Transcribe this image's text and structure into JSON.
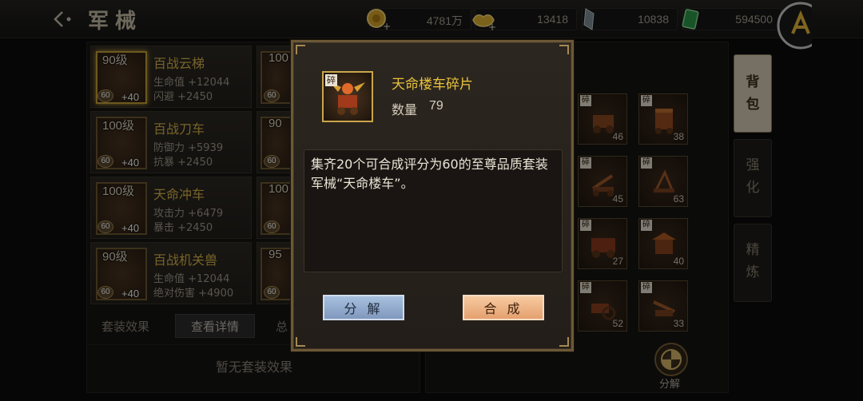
{
  "header": {
    "title": "军械",
    "resources": [
      {
        "icon": "gold-coin-icon",
        "value": "4781万"
      },
      {
        "icon": "gold-ingot-icon",
        "value": "13418"
      },
      {
        "icon": "crystal-icon",
        "value": "10838"
      },
      {
        "icon": "jade-icon",
        "value": "594500"
      }
    ]
  },
  "equipment": [
    {
      "level": "90级",
      "score": "60",
      "plus": "+40",
      "name": "百战云梯",
      "stat1": "生命值 +12044",
      "stat2": "闪避 +2450"
    },
    {
      "level": "100级",
      "score": "60",
      "plus": "+40",
      "name": "百战刀车",
      "stat1": "防御力 +5939",
      "stat2": "抗暴 +2450"
    },
    {
      "level": "100级",
      "score": "60",
      "plus": "+40",
      "name": "天命冲车",
      "stat1": "攻击力 +6479",
      "stat2": "暴击 +2450"
    },
    {
      "level": "90级",
      "score": "60",
      "plus": "+40",
      "name": "百战机关兽",
      "stat1": "生命值 +12044",
      "stat2": "绝对伤害 +4900"
    }
  ],
  "equipment_right": [
    {
      "level": "100",
      "score": "60"
    },
    {
      "level": "90",
      "score": "60"
    },
    {
      "level": "100",
      "score": "60"
    },
    {
      "level": "95",
      "score": "60"
    }
  ],
  "set_section": {
    "label": "套装效果",
    "detail_button": "查看详情",
    "total_label": "总",
    "empty_text": "暂无套装效果"
  },
  "bag": {
    "fragment_tag": "碎",
    "slots": [
      {
        "count": "46"
      },
      {
        "count": "38"
      },
      {
        "count": "45"
      },
      {
        "count": "63"
      },
      {
        "count": "27"
      },
      {
        "count": "40"
      },
      {
        "count": "52"
      },
      {
        "count": "33"
      }
    ],
    "decompose_label": "分解"
  },
  "side_tabs": [
    {
      "label": "背包",
      "active": true
    },
    {
      "label": "强化",
      "active": false
    },
    {
      "label": "精炼",
      "active": false
    }
  ],
  "modal": {
    "fragment_tag": "碎",
    "title": "天命楼车碎片",
    "quantity_label": "数量",
    "quantity": "79",
    "description": "集齐20个可合成评分为60的至尊品质套装军械“天命楼车”。",
    "decompose_button": "分 解",
    "synthesize_button": "合 成"
  },
  "colors": {
    "title_gold": "#e8c23c",
    "decompose_blue": "#a8c0de",
    "synth_orange": "#f7caa0"
  }
}
